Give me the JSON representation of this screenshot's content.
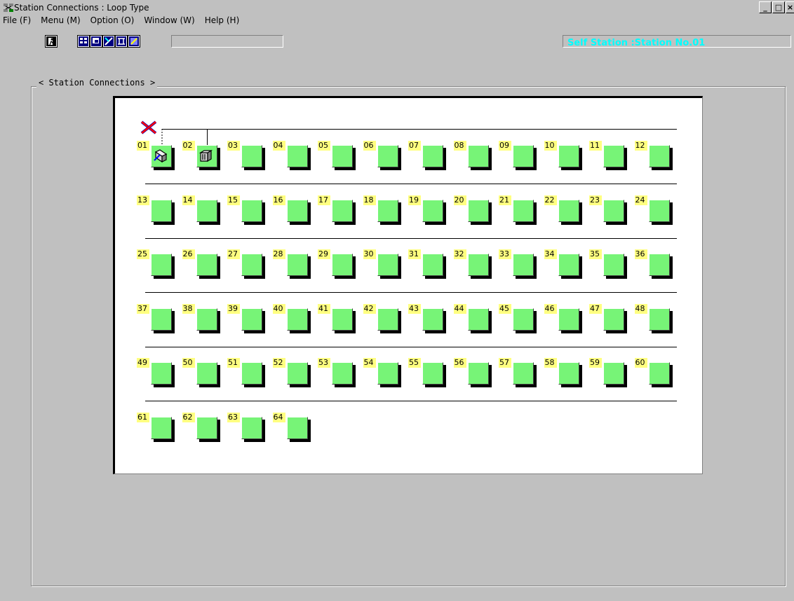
{
  "window": {
    "title": "Station Connections : Loop Type",
    "app_icon": "network-icon",
    "controls": [
      "_",
      "□",
      "×"
    ]
  },
  "menu": {
    "items": [
      "File (F)",
      "Menu (M)",
      "Option (O)",
      "Window (W)",
      "Help (H)"
    ]
  },
  "toolbar": {
    "buttons": [
      "exit-icon",
      "station-list-icon",
      "station-detail-icon",
      "loop-test-icon",
      "network-test-icon",
      "monitor-icon"
    ],
    "status_field": "",
    "self_station": "Self Station :Station No.01"
  },
  "panel": {
    "label": "< Station Connections >"
  },
  "colors": {
    "station_fill": "#80ff80",
    "station_number_bg": "#ffff80",
    "self_station_text": "#00ffff",
    "loop_error": "#ff0000"
  },
  "stations": [
    "01",
    "02",
    "03",
    "04",
    "05",
    "06",
    "07",
    "08",
    "09",
    "10",
    "11",
    "12",
    "13",
    "14",
    "15",
    "16",
    "17",
    "18",
    "19",
    "20",
    "21",
    "22",
    "23",
    "24",
    "25",
    "26",
    "27",
    "28",
    "29",
    "30",
    "31",
    "32",
    "33",
    "34",
    "35",
    "36",
    "37",
    "38",
    "39",
    "40",
    "41",
    "42",
    "43",
    "44",
    "45",
    "46",
    "47",
    "48",
    "49",
    "50",
    "51",
    "52",
    "53",
    "54",
    "55",
    "56",
    "57",
    "58",
    "59",
    "60",
    "61",
    "62",
    "63",
    "64"
  ],
  "station_icons": {
    "01": "station-connected-icon",
    "02": "station-cable-icon"
  },
  "loop_status_icon": "loop-error-icon"
}
